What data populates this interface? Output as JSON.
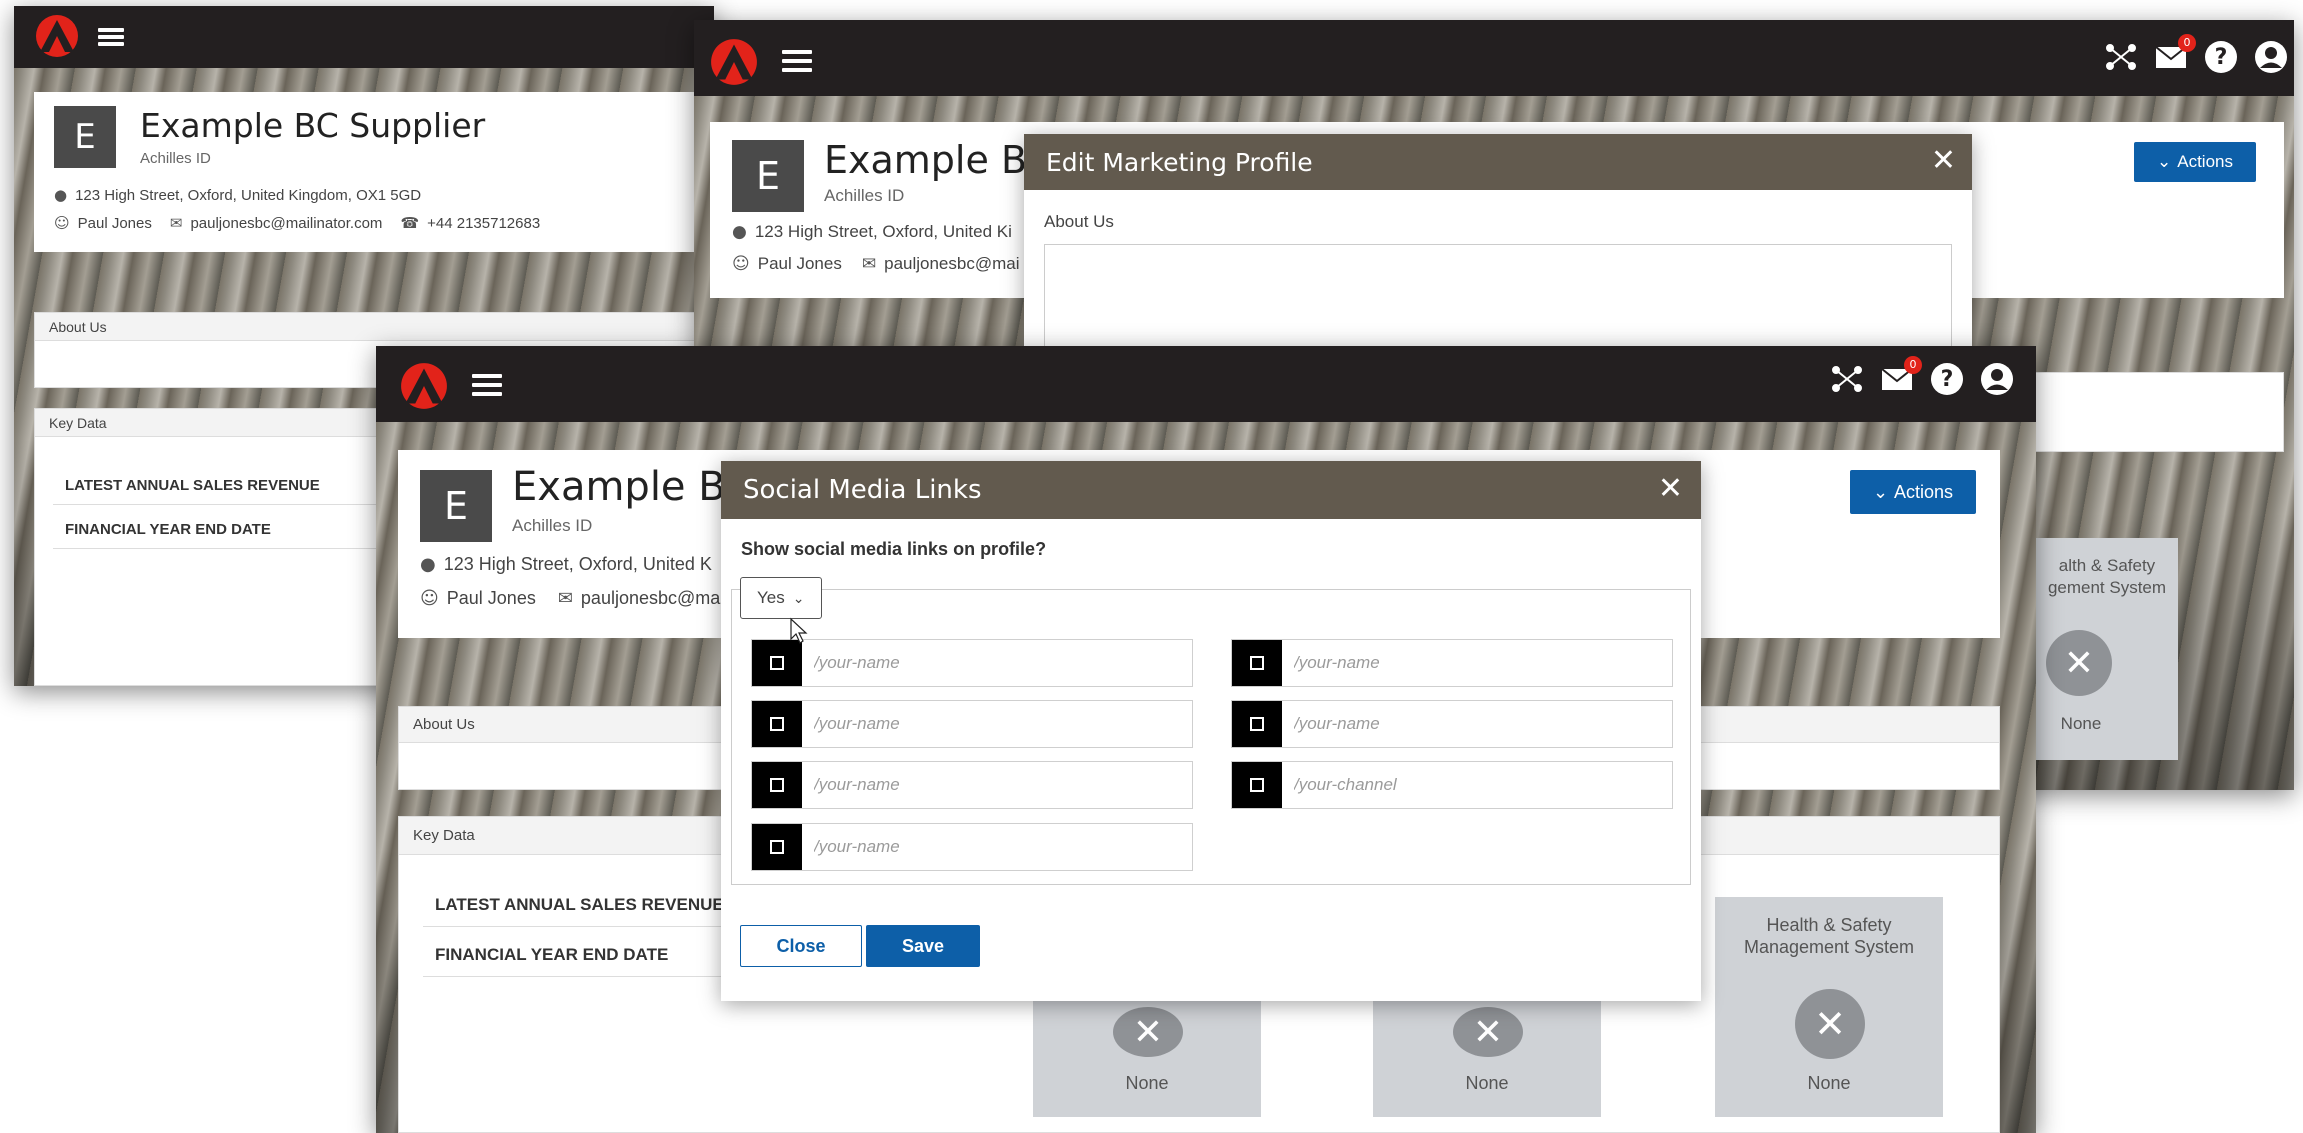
{
  "brand": {
    "accent": "#e2231a",
    "primary": "#0d5fa8",
    "topbar": "#231f20",
    "modal_header": "#625a4e"
  },
  "supplier": {
    "initial": "E",
    "name": "Example BC Supplier",
    "name_truncated": "Example B",
    "achilles_id_label": "Achilles ID",
    "address": "123 High Street, Oxford, United Kingdom, OX1 5GD",
    "address_truncated": "123 High Street, Oxford, United K",
    "address_truncated_short": "123 High Street, Oxford, United Ki",
    "contact_name": "Paul Jones",
    "email": "pauljonesbc@mailinator.com",
    "email_truncated": "pauljonesbc@mai",
    "phone": "+44 2135712683"
  },
  "sections": {
    "about_us": "About Us",
    "key_data": "Key Data",
    "latest_sales": "LATEST ANNUAL SALES REVENUE",
    "fy_end": "FINANCIAL YEAR END DATE"
  },
  "topbar": {
    "mail_badge": "0"
  },
  "actions_label": "Actions",
  "tiles": {
    "hs_title_line1": "Health & Safety",
    "hs_title_line2": "Management System",
    "hs_title_cut_line1": "alth & Safety",
    "hs_title_cut_line2": "gement System",
    "none_label": "None"
  },
  "edit_modal": {
    "title": "Edit Marketing Profile",
    "about_us_label": "About Us"
  },
  "social_modal": {
    "title": "Social Media Links",
    "question": "Show social media links on profile?",
    "select_value": "Yes",
    "fields_left": [
      "/your-name",
      "/your-name",
      "/your-name",
      "/your-name"
    ],
    "fields_right": [
      "/your-name",
      "/your-name",
      "/your-channel"
    ],
    "close_label": "Close",
    "save_label": "Save"
  }
}
